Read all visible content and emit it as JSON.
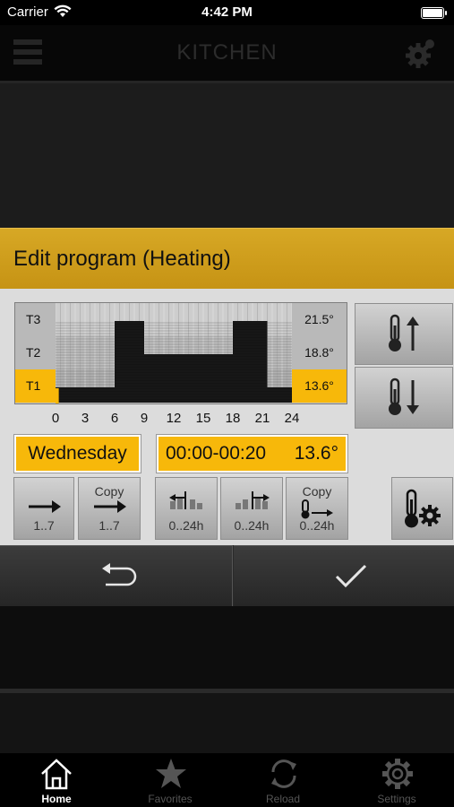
{
  "status_bar": {
    "carrier": "Carrier",
    "time": "4:42 PM"
  },
  "nav": {
    "title": "KITCHEN",
    "menu_icon": "hamburger-icon",
    "settings_icon": "gear-icon"
  },
  "dialog": {
    "title": "Edit program (Heating)",
    "levels": [
      {
        "name": "T3",
        "temp": "21.5°",
        "active": false
      },
      {
        "name": "T2",
        "temp": "18.8°",
        "active": false
      },
      {
        "name": "T1",
        "temp": "13.6°",
        "active": true
      }
    ],
    "hours": [
      "0",
      "3",
      "6",
      "9",
      "12",
      "15",
      "18",
      "21",
      "24"
    ],
    "schedule": [
      {
        "from": 0,
        "to": 6,
        "level": 1
      },
      {
        "from": 6,
        "to": 9,
        "level": 3
      },
      {
        "from": 9,
        "to": 18,
        "level": 2
      },
      {
        "from": 18,
        "to": 21.5,
        "level": 3
      },
      {
        "from": 21.5,
        "to": 24,
        "level": 1
      }
    ],
    "selected_slot_hours": [
      0,
      0.33
    ],
    "day": "Wednesday",
    "time_range": "00:00-00:20",
    "slot_temp": "13.6°",
    "buttons": {
      "next_day_label": "1..7",
      "copy_day_top": "Copy",
      "copy_day_label": "1..7",
      "move_left_label": "0..24h",
      "move_right_label": "0..24h",
      "copy_slot_top": "Copy",
      "copy_slot_label": "0..24h"
    }
  },
  "tabs": [
    {
      "label": "Home",
      "icon": "home-icon",
      "active": true
    },
    {
      "label": "Favorites",
      "icon": "star-icon",
      "active": false
    },
    {
      "label": "Reload",
      "icon": "reload-icon",
      "active": false
    },
    {
      "label": "Settings",
      "icon": "gear-icon",
      "active": false
    }
  ]
}
